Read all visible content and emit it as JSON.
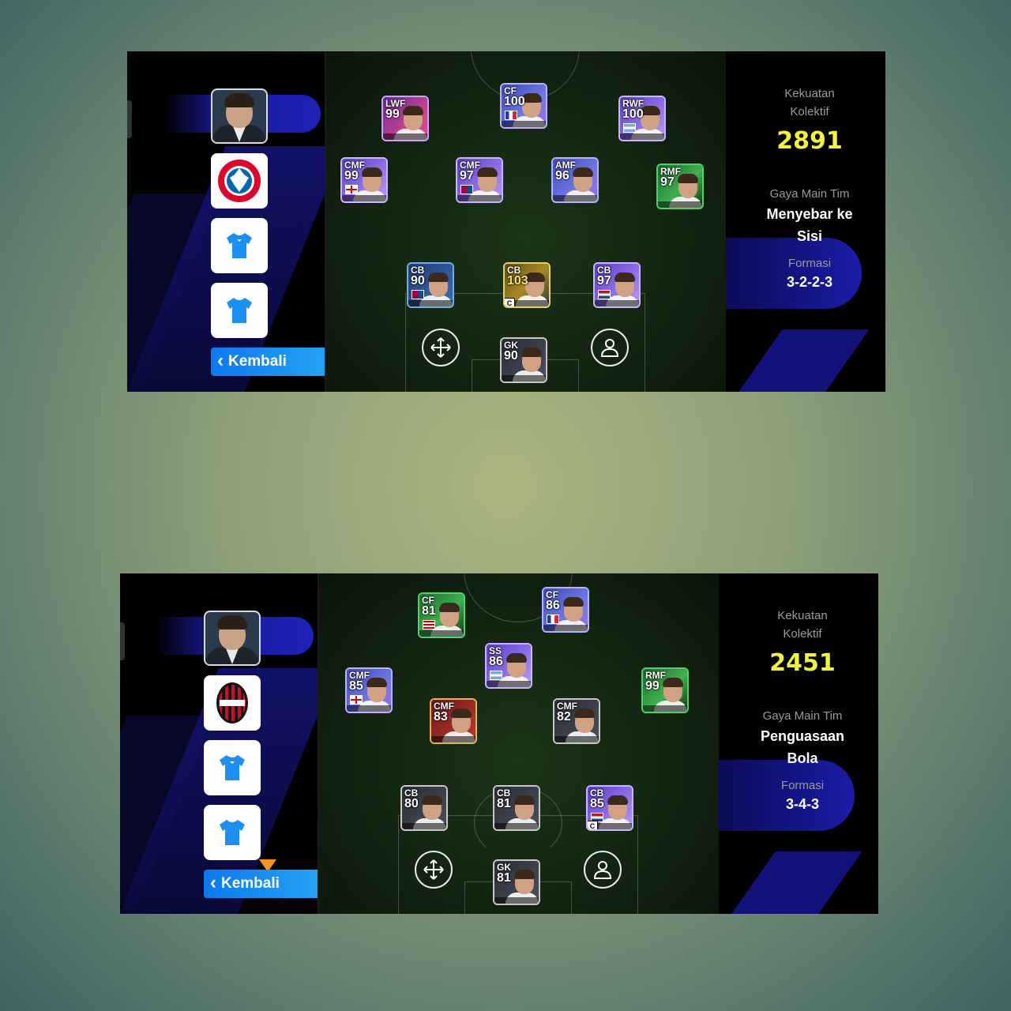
{
  "panels": [
    {
      "back_label": "Kembali",
      "club_name": "FC Bayern München",
      "stats": {
        "power_label": "Kekuatan\nKolektif",
        "power_label_l1": "Kekuatan",
        "power_label_l2": "Kolektif",
        "power_value": "2891",
        "style_label": "Gaya Main Tim",
        "style_value_l1": "Menyebar ke",
        "style_value_l2": "Sisi",
        "formation_label": "Formasi",
        "formation_value": "3-2-2-3"
      },
      "players": [
        {
          "pos": "LWF",
          "ovr": "99",
          "rarity": "epic-pink"
        },
        {
          "pos": "CF",
          "ovr": "100",
          "rarity": "epic-blue",
          "flag": "france"
        },
        {
          "pos": "RWF",
          "ovr": "100",
          "rarity": "epic-purple",
          "flag": "argentina"
        },
        {
          "pos": "CMF",
          "ovr": "99",
          "rarity": "epic-purple",
          "flag": "england"
        },
        {
          "pos": "CMF",
          "ovr": "97",
          "rarity": "epic-purple",
          "flag": "barcelona"
        },
        {
          "pos": "AMF",
          "ovr": "96",
          "rarity": "epic-blue"
        },
        {
          "pos": "RMF",
          "ovr": "97",
          "rarity": "highlight-green"
        },
        {
          "pos": "CB",
          "ovr": "90",
          "rarity": "standard-blue",
          "flag": "barcelona"
        },
        {
          "pos": "CB",
          "ovr": "103",
          "rarity": "show-time",
          "captain": true
        },
        {
          "pos": "CB",
          "ovr": "97",
          "rarity": "epic-purple",
          "flag": "netherlands"
        },
        {
          "pos": "GK",
          "ovr": "90",
          "rarity": "standard-dark"
        }
      ]
    },
    {
      "back_label": "Kembali",
      "club_name": "AC Milan",
      "stats": {
        "power_label_l1": "Kekuatan",
        "power_label_l2": "Kolektif",
        "power_value": "2451",
        "style_label": "Gaya Main Tim",
        "style_value_l1": "Penguasaan",
        "style_value_l2": "Bola",
        "formation_label": "Formasi",
        "formation_value": "3-4-3"
      },
      "players": [
        {
          "pos": "CF",
          "ovr": "81",
          "rarity": "highlight-green",
          "flag": "malaysia"
        },
        {
          "pos": "CF",
          "ovr": "86",
          "rarity": "epic-blue",
          "flag": "france"
        },
        {
          "pos": "SS",
          "ovr": "86",
          "rarity": "epic-purple",
          "flag": "argentina"
        },
        {
          "pos": "CMF",
          "ovr": "85",
          "rarity": "epic-blue",
          "flag": "england"
        },
        {
          "pos": "RMF",
          "ovr": "99",
          "rarity": "highlight-green"
        },
        {
          "pos": "CMF",
          "ovr": "83",
          "rarity": "standard-red"
        },
        {
          "pos": "CMF",
          "ovr": "82",
          "rarity": "standard-dark"
        },
        {
          "pos": "CB",
          "ovr": "80",
          "rarity": "standard-dark"
        },
        {
          "pos": "CB",
          "ovr": "81",
          "rarity": "standard-dark"
        },
        {
          "pos": "CB",
          "ovr": "85",
          "rarity": "epic-purple",
          "flag": "netherlands",
          "captain": true
        },
        {
          "pos": "GK",
          "ovr": "81",
          "rarity": "standard-dark"
        }
      ]
    }
  ],
  "icons": [
    "manager-portrait",
    "club-badge",
    "home-kit-shirt-icon",
    "away-kit-shirt-icon",
    "move-arrows-icon",
    "player-profile-icon",
    "chevron-left-icon",
    "captain-badge"
  ],
  "colors": {
    "accent_blue": "#1b8ff2",
    "power_yellow": "#f3f33a",
    "pitch_green": "#142712",
    "cursor_orange": "#f7941d"
  }
}
